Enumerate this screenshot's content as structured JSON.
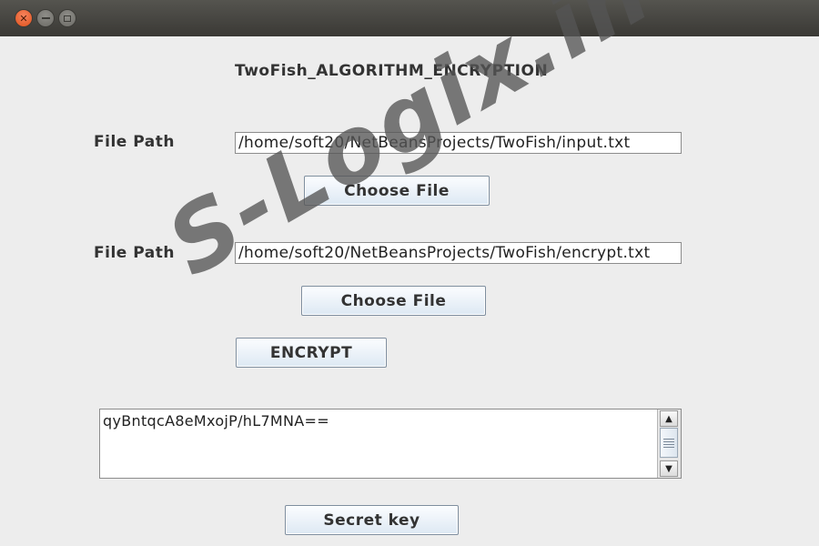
{
  "window": {
    "controls": {
      "close_icon": "close-icon",
      "minimize_icon": "minimize-icon",
      "maximize_icon": "maximize-icon"
    }
  },
  "heading": "TwoFish_ALGORITHM_ENCRYPTION",
  "input_file": {
    "label": "File Path",
    "value": "/home/soft20/NetBeansProjects/TwoFish/input.txt",
    "button": "Choose File"
  },
  "output_file": {
    "label": "File Path",
    "value": "/home/soft20/NetBeansProjects/TwoFish/encrypt.txt",
    "button": "Choose File"
  },
  "encrypt_button": "ENCRYPT",
  "output_area": {
    "text": "qyBntqcA8eMxojP/hL7MNA=="
  },
  "secret_key_button": "Secret key",
  "watermark": "S-Logix.in",
  "colors": {
    "background": "#ededed",
    "titlebar": "#3c3b37",
    "close": "#e95420"
  }
}
